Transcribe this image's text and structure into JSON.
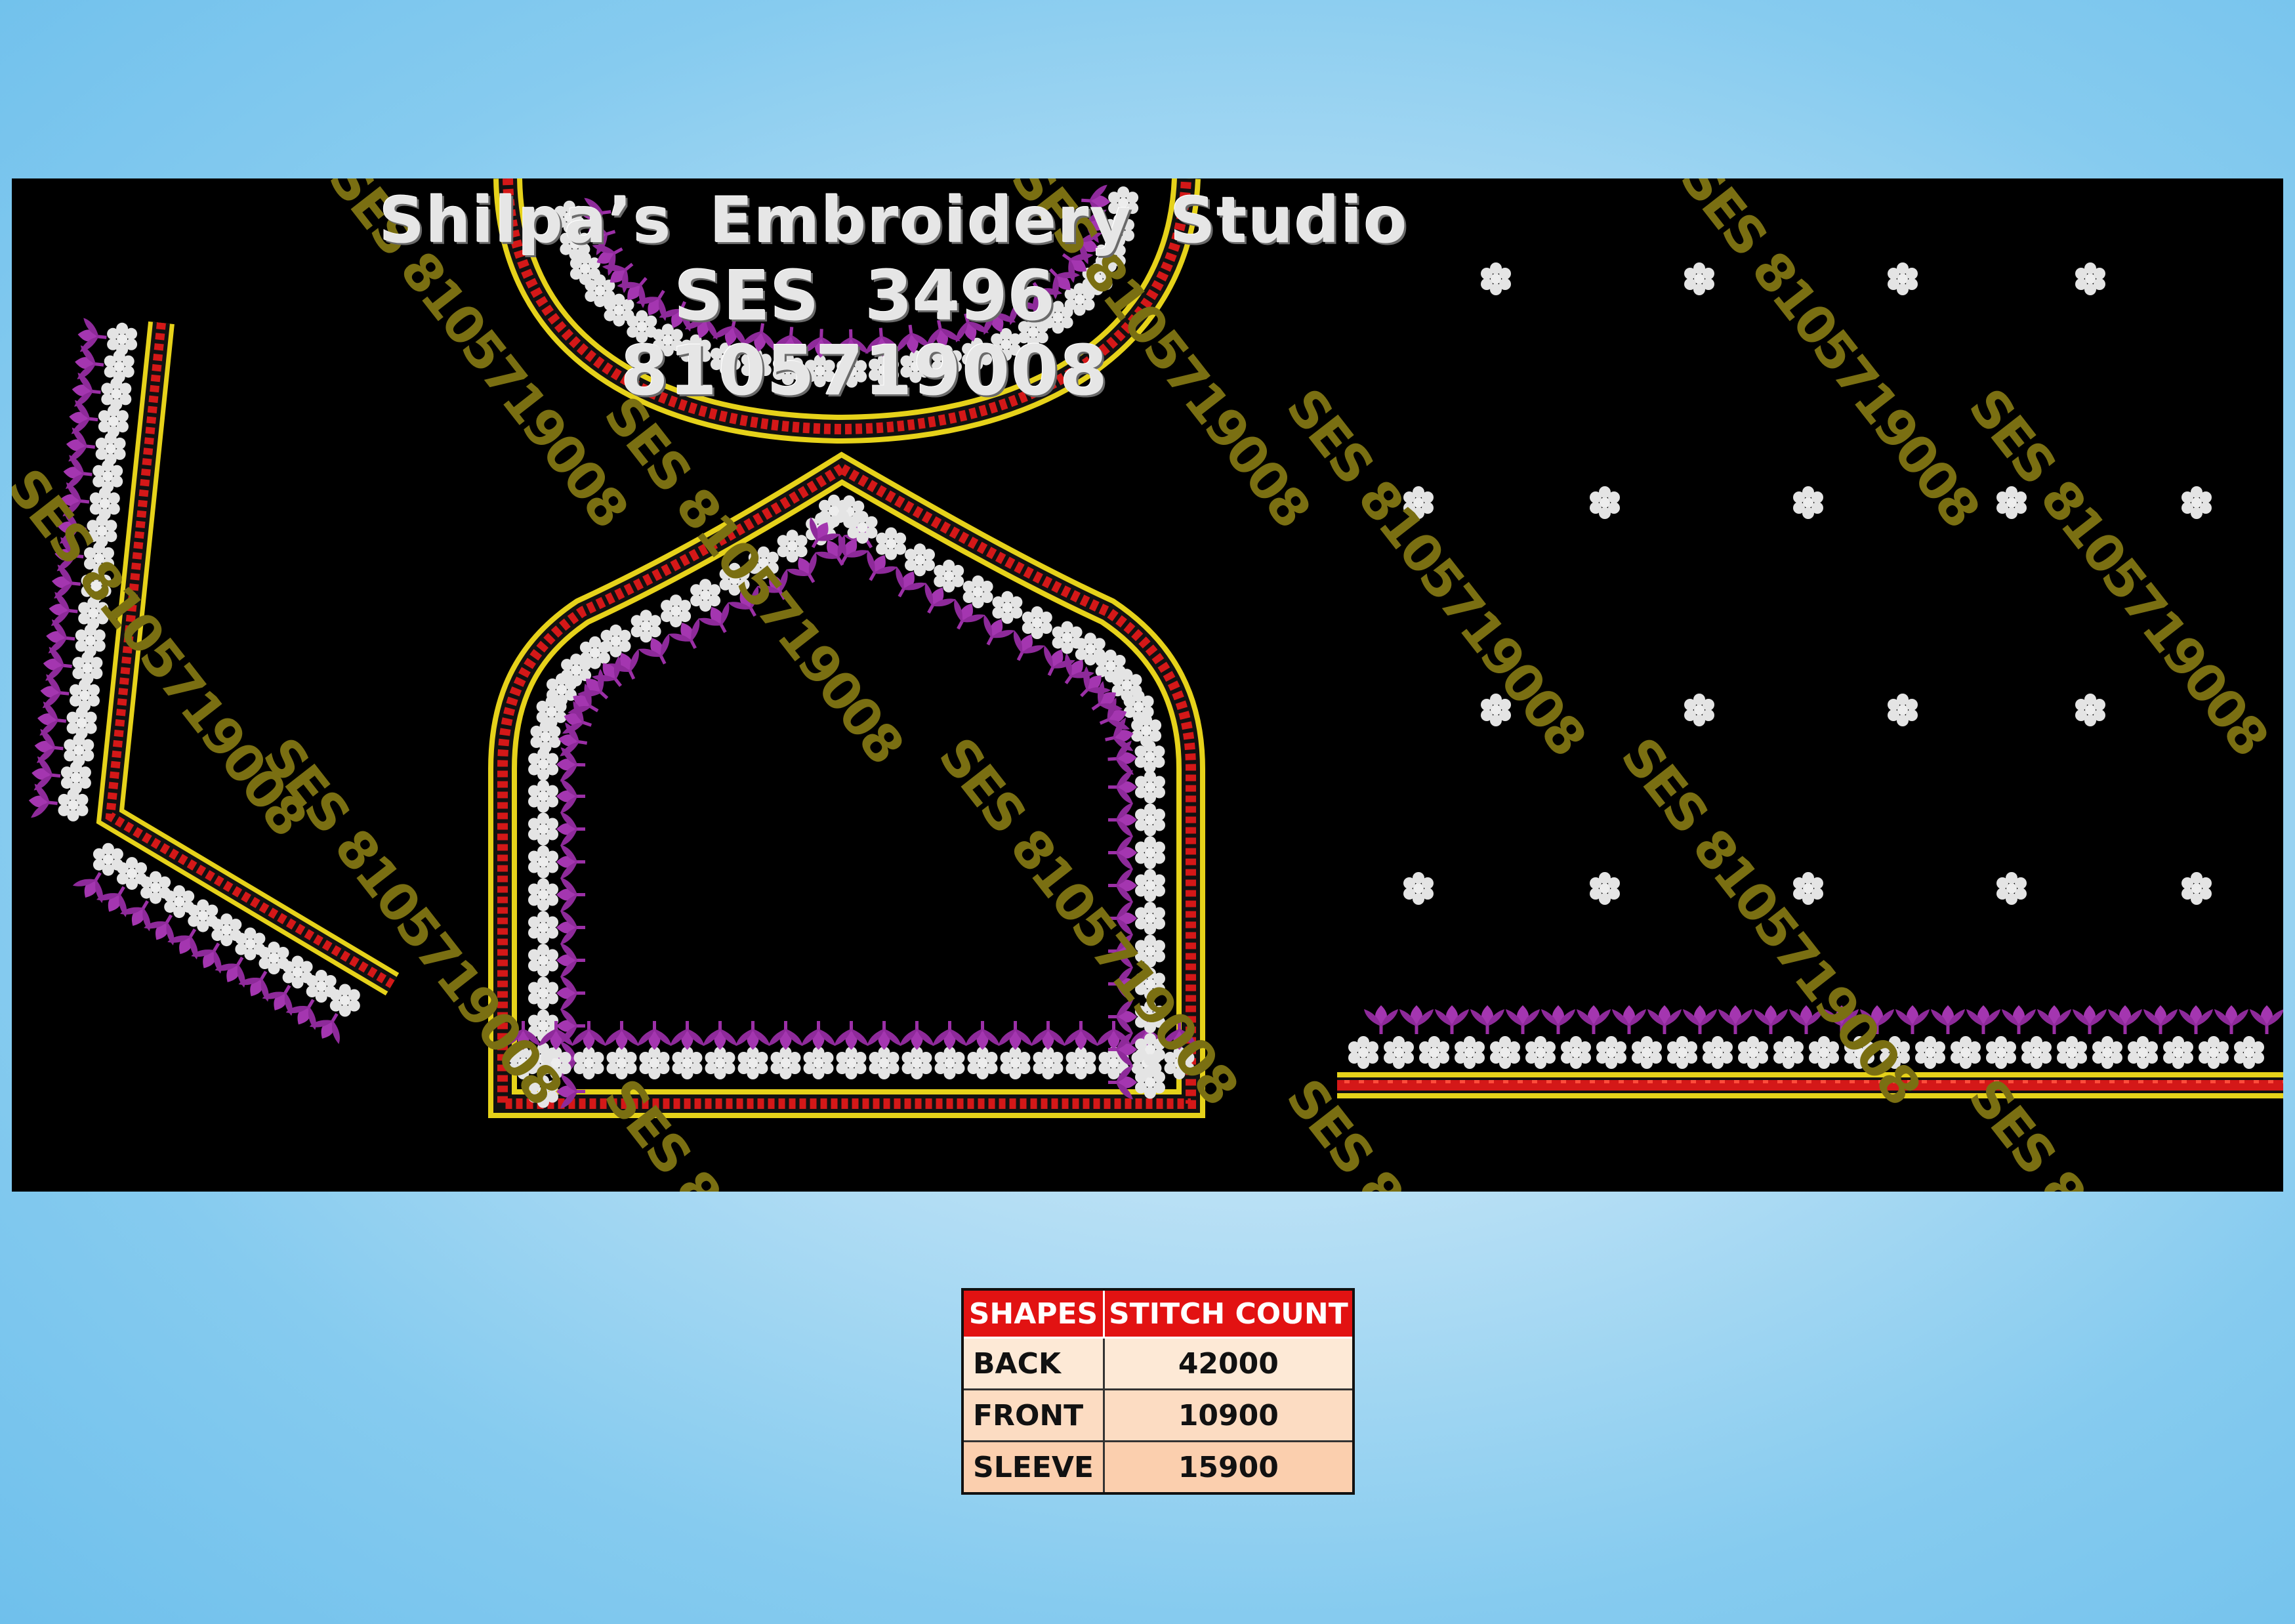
{
  "header": {
    "studio_name": "Shilpa’s Embroidery Studio",
    "design_code": "SES 3496",
    "phone": "8105719008"
  },
  "watermark": {
    "text": "SES 8105719008",
    "color": "#7a6f12"
  },
  "palette": {
    "panel_background": "#000000",
    "outline_gold": "#e6d21a",
    "chain_red": "#e02020",
    "leaf_purple": "#9b2fa6",
    "pearl_white": "#e8e8e8"
  },
  "table": {
    "headers": [
      "SHAPES",
      "STITCH COUNT"
    ],
    "rows": [
      {
        "shape": "BACK",
        "count": "42000"
      },
      {
        "shape": "FRONT",
        "count": "10900"
      },
      {
        "shape": "SLEEVE",
        "count": "15900"
      }
    ]
  }
}
